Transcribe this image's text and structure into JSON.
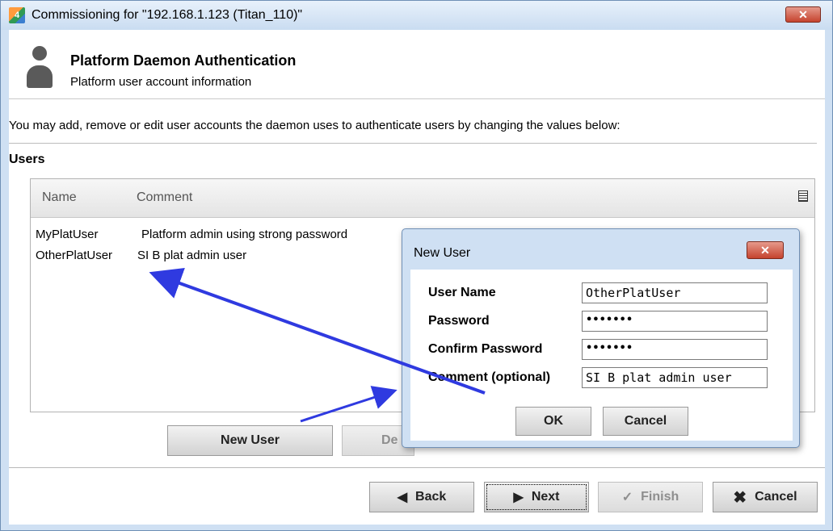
{
  "window": {
    "title": "Commissioning for \"192.168.1.123 (Titan_110)\"",
    "close_symbol": "✕"
  },
  "header": {
    "title": "Platform Daemon Authentication",
    "subtitle": "Platform user account information",
    "icon": "user-icon"
  },
  "content": {
    "instruction": "You may add, remove or edit user accounts the daemon uses to authenticate users by changing the values below:",
    "users_label": "Users",
    "table": {
      "columns": [
        "Name",
        "Comment"
      ],
      "rows": [
        {
          "name": "MyPlatUser",
          "comment": "Platform admin using strong password"
        },
        {
          "name": "OtherPlatUser",
          "comment": "SI B plat admin user"
        }
      ]
    },
    "buttons": {
      "new_user": "New User",
      "delete_partial": "De"
    }
  },
  "footer": {
    "back": "Back",
    "next": "Next",
    "finish": "Finish",
    "cancel": "Cancel"
  },
  "dialog": {
    "title": "New User",
    "close_symbol": "✕",
    "fields": {
      "user_name_label": "User Name",
      "user_name_value": "OtherPlatUser",
      "password_label": "Password",
      "password_value": "•••••••",
      "confirm_label": "Confirm Password",
      "confirm_value": "•••••••",
      "comment_label": "Comment (optional)",
      "comment_value": "SI B plat admin user"
    },
    "ok": "OK",
    "cancel": "Cancel"
  },
  "colors": {
    "arrow": "#2f3ae0",
    "titlebar": "#c9dcf1",
    "close": "#c5432e"
  }
}
